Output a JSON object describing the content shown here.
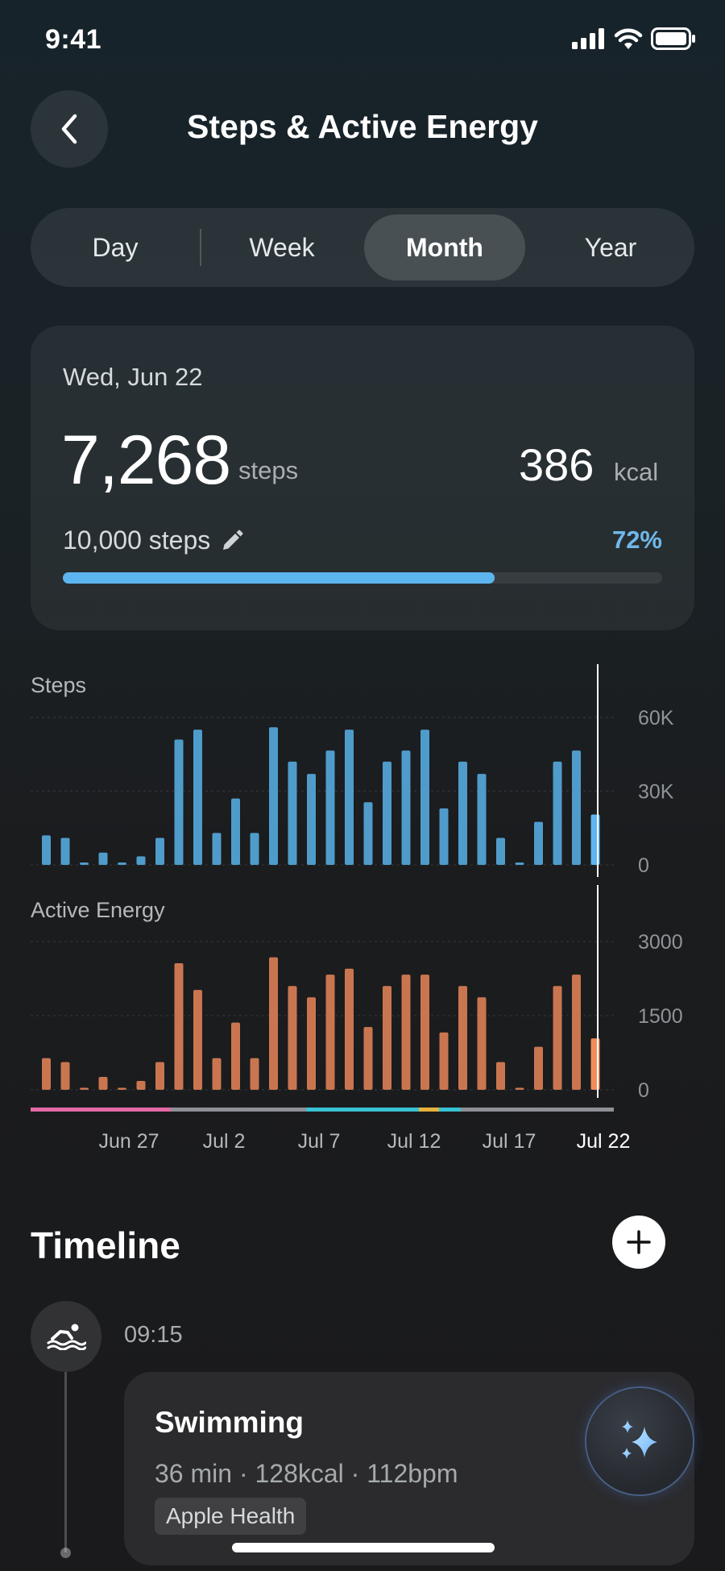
{
  "status": {
    "time": "9:41"
  },
  "header": {
    "title": "Steps & Active Energy",
    "back_icon": "chevron-left-icon"
  },
  "tabs": [
    {
      "label": "Day",
      "active": false
    },
    {
      "label": "Week",
      "active": false
    },
    {
      "label": "Month",
      "active": true
    },
    {
      "label": "Year",
      "active": false
    }
  ],
  "summary": {
    "date": "Wed, Jun 22",
    "steps_value": "7,268",
    "steps_unit": "steps",
    "kcal_value": "386",
    "kcal_unit": "kcal",
    "goal_text": "10,000 steps",
    "goal_percent_text": "72%",
    "progress": 0.72
  },
  "chart_data": [
    {
      "type": "bar",
      "title": "Steps",
      "ylim": [
        0,
        60000
      ],
      "yticks": [
        "60K",
        "30K",
        "0"
      ],
      "color": "#4f9ccb",
      "highlight_color": "#5db5ef",
      "values": [
        12000,
        11000,
        1000,
        5000,
        1000,
        3500,
        11000,
        51000,
        55000,
        13000,
        27000,
        13000,
        56000,
        42000,
        37000,
        46500,
        55000,
        25500,
        42000,
        46500,
        55000,
        23000,
        42000,
        37000,
        11000,
        1000,
        17500,
        42000,
        46500,
        20500
      ]
    },
    {
      "type": "bar",
      "title": "Active Energy",
      "ylim": [
        0,
        3000
      ],
      "yticks": [
        "3000",
        "1500",
        "0"
      ],
      "color": "#c97650",
      "highlight_color": "#f08c5c",
      "values": [
        640,
        560,
        40,
        260,
        40,
        180,
        560,
        2560,
        2020,
        640,
        1360,
        640,
        2680,
        2100,
        1870,
        2330,
        2450,
        1270,
        2100,
        2330,
        2330,
        1160,
        2100,
        1870,
        560,
        40,
        870,
        2100,
        2330,
        1040
      ]
    }
  ],
  "x_labels": [
    "Jun 27",
    "Jul 2",
    "Jul 7",
    "Jul 12",
    "Jul 17",
    "Jul 22"
  ],
  "timeline": {
    "title": "Timeline",
    "entry": {
      "time": "09:15",
      "icon": "swimming-icon",
      "title": "Swimming",
      "meta": "36 min · 128kcal · 112bpm",
      "source": "Apple Health"
    }
  }
}
